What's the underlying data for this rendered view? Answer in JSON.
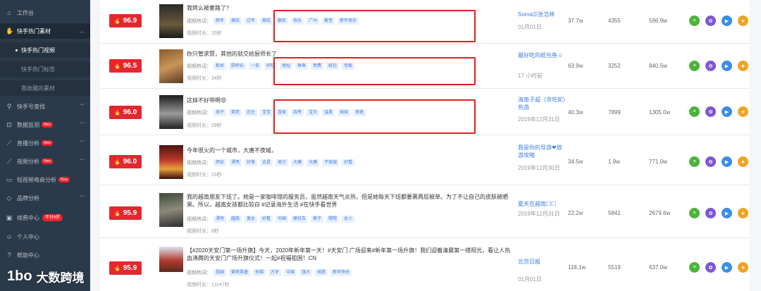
{
  "sidebar": {
    "items": [
      {
        "label": "工作台",
        "icon": "home-icon"
      },
      {
        "label": "快手热门素材",
        "icon": "hand-icon"
      },
      {
        "label": "快手热门视频"
      },
      {
        "label": "快手热门标签"
      },
      {
        "label": "我收藏的素材"
      },
      {
        "label": "快手号查找",
        "icon": "search-icon"
      },
      {
        "label": "数据监测",
        "icon": "monitor-icon",
        "badge": "New"
      },
      {
        "label": "直播分析",
        "icon": "live-icon",
        "badge": "New"
      },
      {
        "label": "视频分析",
        "icon": "video-icon",
        "badge": "New"
      },
      {
        "label": "短视频电商分析",
        "icon": "cart-icon",
        "badge": "New"
      },
      {
        "label": "品牌分析",
        "icon": "brand-icon"
      },
      {
        "label": "续费中心",
        "icon": "renew-icon",
        "badge": "年付6折"
      },
      {
        "label": "个人中心",
        "icon": "user-icon"
      },
      {
        "label": "帮助中心",
        "icon": "help-icon"
      }
    ]
  },
  "rows": [
    {
      "score": "96.9",
      "title": "我转么被套路了？",
      "tag_label": "视频热词：",
      "tags": [
        "跨年",
        "烟花",
        "过年",
        "烟花",
        "翻名",
        "快乐",
        "广州",
        "教堂",
        "新年快乐"
      ],
      "duration": "视频时长：15秒",
      "author": "Soma☰张浩林",
      "date": "01月01日",
      "plays": "37.7w",
      "comments": "4355",
      "likes": "596.9w"
    },
    {
      "score": "96.5",
      "title": "你只管求赞，其他的就交给厨师长了",
      "tag_label": "视频热词：",
      "tags": [
        "粉丝",
        "厨师长",
        "一条",
        "好吃",
        "地址",
        "鱼鱼",
        "免费",
        "纸包",
        "老板"
      ],
      "duration": "视频时长：34秒",
      "author": "最好吃的纸包鱼☺",
      "date": "17 小时前",
      "plays": "63.9w",
      "comments": "3252",
      "likes": "840.5w"
    },
    {
      "score": "96.0",
      "title": "这妹不好带啊😡",
      "tag_label": "视频热词：",
      "tags": [
        "孩子",
        "笑死",
        "忍住",
        "宝宝",
        "我家",
        "四爷",
        "宝贝",
        "温柔",
        "妹妹",
        "爸爸"
      ],
      "duration": "视频时长：29秒",
      "author": "海南子超（贪吃蛇）热游",
      "date": "2019年12月31日",
      "plays": "40.3w",
      "comments": "7899",
      "likes": "1305.0w"
    },
    {
      "score": "96.0",
      "title": "今年很火的一个城市，大唐不夜城，",
      "tag_label": "视频热词：",
      "tags": [
        "西安",
        "漂亮",
        "好美",
        "这是",
        "地方",
        "大唐",
        "大唐",
        "不夜城",
        "好看"
      ],
      "duration": "视频时长：15秒",
      "author": "我是你的导游❤旅游攻略",
      "date": "2019年12月30日",
      "plays": "34.5w",
      "comments": "1.9w",
      "likes": "771.0w"
    },
    {
      "score": "95.9",
      "title": "我的越南朋友下班了。她是一家咖啡馆的服务员，虽然越南天气炎热，但是她每天下班都要裹两层被单。为了不让自己的皮肤被晒黑。所以，越南女孩都比较白 #记录海外生活 #在快手看世界",
      "tag_label": "视频热词：",
      "tags": [
        "漂亮",
        "越南",
        "美女",
        "好看",
        "中国",
        "摩托车",
        "裤子",
        "嗯嗯",
        "女人"
      ],
      "duration": "视频时长：8秒",
      "author": "夏天在越南☐☐",
      "date": "2019年12月31日",
      "plays": "22.2w",
      "comments": "5841",
      "likes": "2679.6w"
    },
    {
      "score": "95.9",
      "title": "【#2020天安门第一场升旗】今天，2020年新年第一天！#天安门 广场迎来#新年第一场升旗！我们迎着清晨第一缕阳光，看让人热血沸腾的天安门广场升旗仪式！一起#祝福祖国！CN",
      "tag_label": "视频热词：",
      "tags": [
        "祖国",
        "繁荣昌盛",
        "祝福",
        "万岁",
        "中国",
        "强大",
        "祝愿",
        "新年快乐"
      ],
      "duration": "视频时长：1分47秒",
      "author": "北京日报",
      "date": "01月01日",
      "plays": "118.1w",
      "comments": "5519",
      "likes": "637.0w"
    }
  ],
  "watermark": "大数跨境",
  "watermark_logo": "1bo"
}
